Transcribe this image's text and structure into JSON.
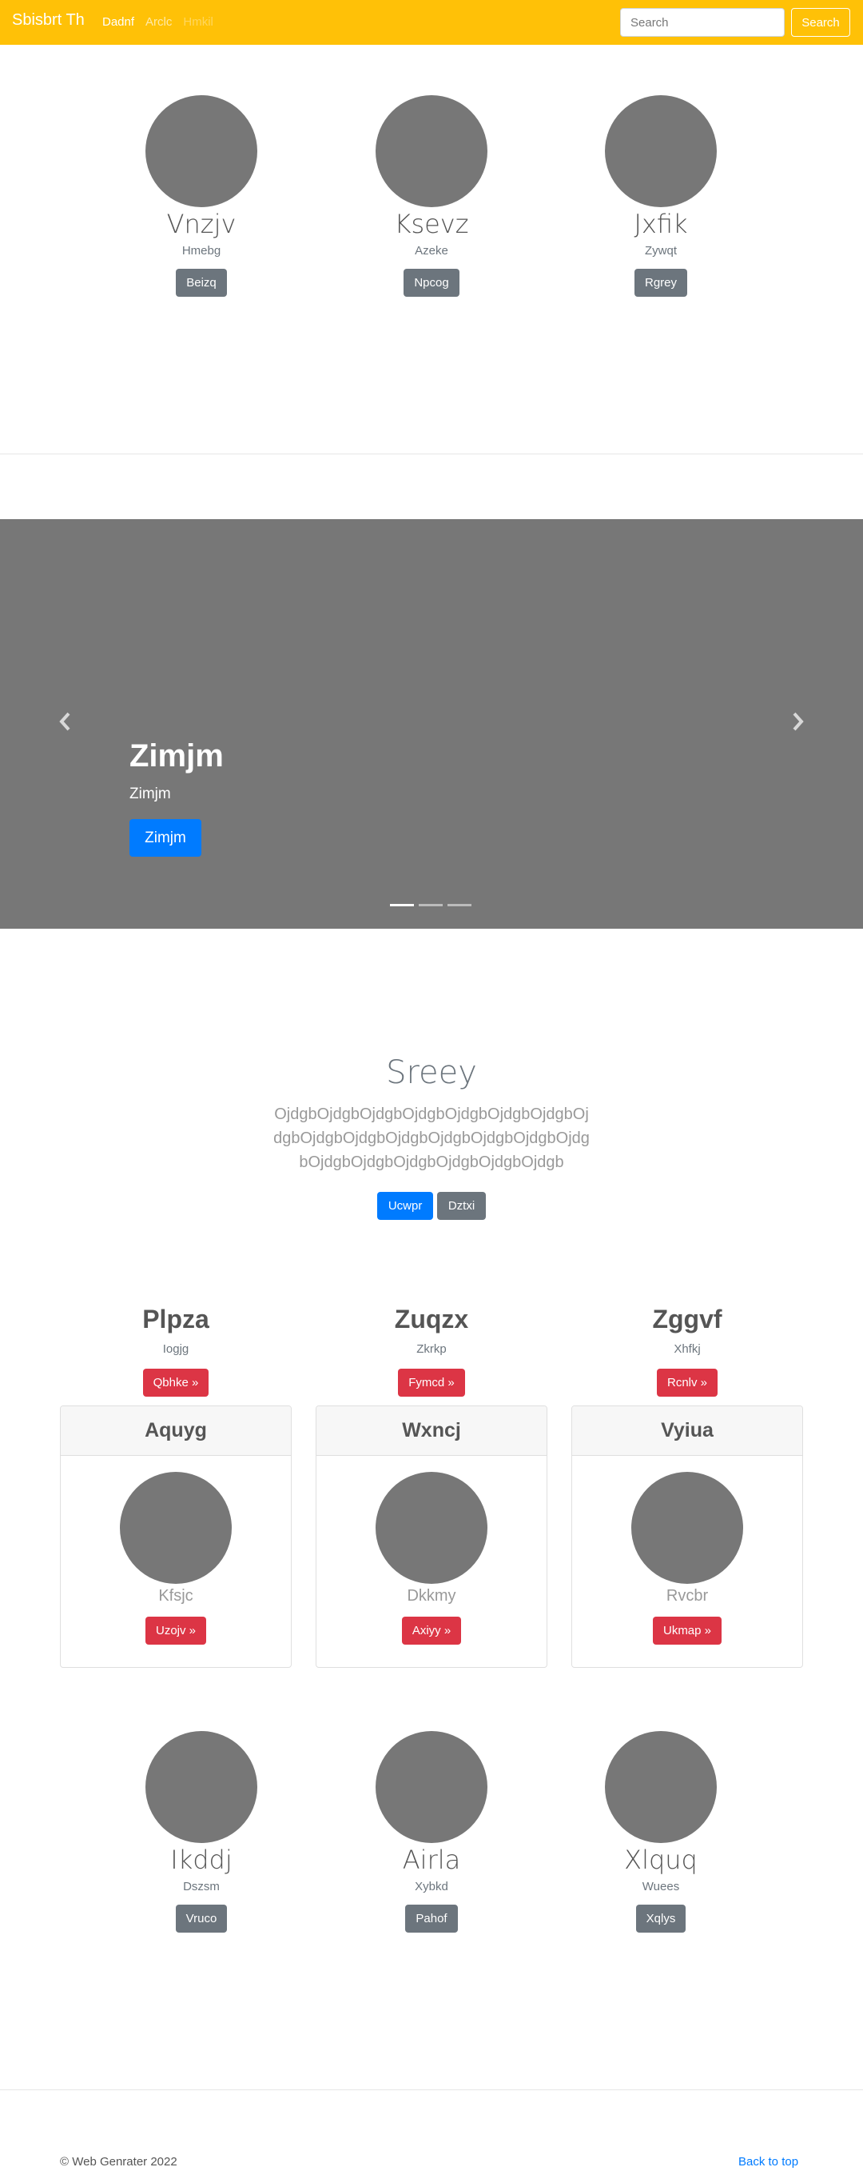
{
  "navbar": {
    "brand": "Sbisbrt Th",
    "links": [
      {
        "label": "Dadnf",
        "state": "active"
      },
      {
        "label": "Arclc",
        "state": "normal"
      },
      {
        "label": "Hmkil",
        "state": "disabled"
      }
    ],
    "search_placeholder": "Search",
    "search_button": "Search"
  },
  "profiles_top": [
    {
      "name": "Vnzjv",
      "sub": "Hmebg",
      "button": "Beizq"
    },
    {
      "name": "Ksevz",
      "sub": "Azeke",
      "button": "Npcog"
    },
    {
      "name": "Jxfik",
      "sub": "Zywqt",
      "button": "Rgrey"
    }
  ],
  "carousel": {
    "title": "Zimjm",
    "subtitle": "Zimjm",
    "button": "Zimjm",
    "slide_count": 3,
    "active_index": 0
  },
  "lead": {
    "title": "Sreey",
    "text": "OjdgbOjdgbOjdgbOjdgbOjdgbOjdgbOjdgbOjdgbOjdgbOjdgbOjdgbOjdgbOjdgbOjdgbOjdgbOjdgbOjdgbOjdgbOjdgbOjdgbOjdgb",
    "primary_button": "Ucwpr",
    "secondary_button": "Dztxi"
  },
  "columns": [
    {
      "heading": "Plpza",
      "sub": "Iogjg",
      "button": "Qbhke »"
    },
    {
      "heading": "Zuqzx",
      "sub": "Zkrkp",
      "button": "Fymcd »"
    },
    {
      "heading": "Zggvf",
      "sub": "Xhfkj",
      "button": "Rcnlv »"
    }
  ],
  "cards": [
    {
      "header": "Aquyg",
      "sub": "Kfsjc",
      "button": "Uzojv »"
    },
    {
      "header": "Wxncj",
      "sub": "Dkkmy",
      "button": "Axiyy »"
    },
    {
      "header": "Vyiua",
      "sub": "Rvcbr",
      "button": "Ukmap »"
    }
  ],
  "profiles_bottom": [
    {
      "name": "Ikddj",
      "sub": "Dszsm",
      "button": "Vruco"
    },
    {
      "name": "Airla",
      "sub": "Xybkd",
      "button": "Pahof"
    },
    {
      "name": "Xlquq",
      "sub": "Wuees",
      "button": "Xqlys"
    }
  ],
  "footer": {
    "copyright": "© Web Genrater 2022",
    "back_to_top": "Back to top"
  },
  "colors": {
    "navbar": "#ffc107",
    "placeholder": "#777777",
    "primary": "#007bff",
    "secondary": "#6c757d",
    "danger": "#dc3545"
  }
}
